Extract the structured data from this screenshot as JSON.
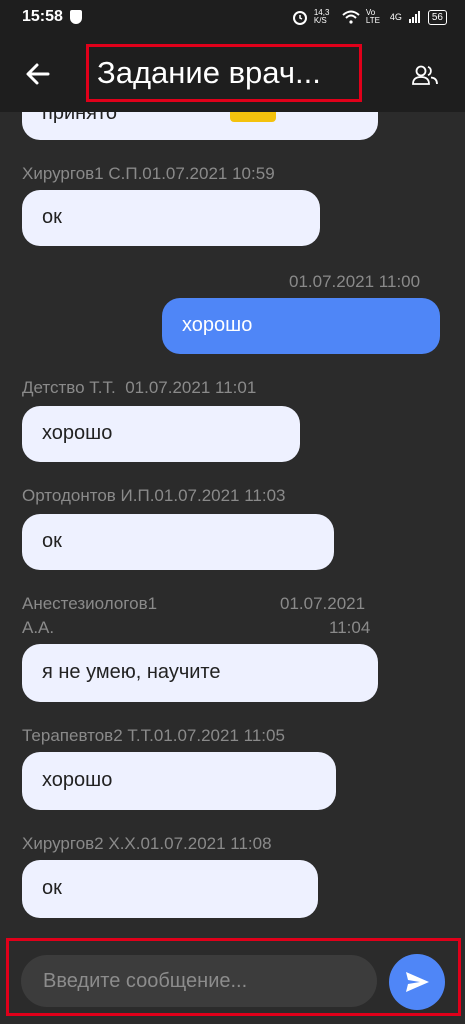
{
  "status_bar": {
    "time": "15:58",
    "speed": "14,3 K/S",
    "network": "Vo LTE",
    "signal": "4G",
    "battery": "56"
  },
  "header": {
    "title": "Задание врач..."
  },
  "messages": [
    {
      "text": "принято",
      "direction": "in"
    },
    {
      "meta": "Хирургов1 С.П.01.07.2021 10:59",
      "text": "ок",
      "direction": "in"
    },
    {
      "meta": "01.07.2021 11:00",
      "text": "хорошо",
      "direction": "out"
    },
    {
      "meta": "Детство Т.Т.  01.07.2021 11:01",
      "text": "хорошо",
      "direction": "in"
    },
    {
      "meta": "Ортодонтов И.П.01.07.2021 11:03",
      "text": "ок",
      "direction": "in"
    },
    {
      "meta_name_1": "Анестезиологов1",
      "meta_name_2": "А.А.",
      "meta_date": "01.07.2021",
      "meta_time": "11:04",
      "text": "я не умею, научите",
      "direction": "in"
    },
    {
      "meta": "Терапевтов2 Т.Т.01.07.2021 11:05",
      "text": "хорошо",
      "direction": "in"
    },
    {
      "meta": "Хирургов2 Х.Х.01.07.2021 11:08",
      "text": "ок",
      "direction": "in"
    }
  ],
  "composer": {
    "placeholder": "Введите сообщение..."
  },
  "colors": {
    "background": "#2b2b2b",
    "incoming_bubble": "#eef1ff",
    "outgoing_bubble": "#4f86f7",
    "highlight": "#e0001a"
  }
}
